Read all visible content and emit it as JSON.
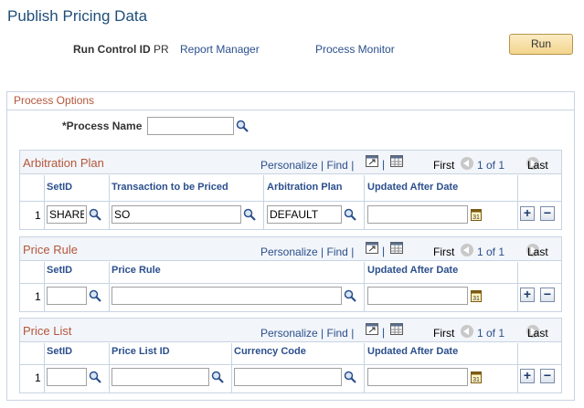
{
  "page": {
    "title": "Publish Pricing Data"
  },
  "run_control": {
    "label": "Run Control ID",
    "value": "PR",
    "report_manager": "Report Manager",
    "process_monitor": "Process Monitor",
    "run_button": "Run"
  },
  "process_options": {
    "title": "Process Options",
    "process_name_label": "*Process Name",
    "process_name_value": ""
  },
  "arbitration_plan": {
    "title": "Arbitration Plan",
    "personalize": "Personalize",
    "find": "Find",
    "first": "First",
    "range": "1 of 1",
    "last": "Last",
    "columns": [
      "SetID",
      "Transaction to be Priced",
      "Arbitration Plan",
      "Updated After Date"
    ],
    "rows": [
      {
        "num": "1",
        "setid": "SHARE",
        "transaction": "SO",
        "plan": "DEFAULT",
        "date": ""
      }
    ]
  },
  "price_rule": {
    "title": "Price Rule",
    "personalize": "Personalize",
    "find": "Find",
    "first": "First",
    "range": "1 of 1",
    "last": "Last",
    "columns": [
      "SetID",
      "Price Rule",
      "Updated After Date"
    ],
    "rows": [
      {
        "num": "1",
        "setid": "",
        "rule": "",
        "date": ""
      }
    ]
  },
  "price_list": {
    "title": "Price List",
    "personalize": "Personalize",
    "find": "Find",
    "first": "First",
    "range": "1 of 1",
    "last": "Last",
    "columns": [
      "SetID",
      "Price List ID",
      "Currency Code",
      "Updated After Date"
    ],
    "rows": [
      {
        "num": "1",
        "setid": "",
        "list_id": "",
        "currency": "",
        "date": ""
      }
    ]
  },
  "separator": "|",
  "colors": {
    "title": "#1f4e79",
    "link": "#2b4f8c",
    "section": "#b4563c",
    "border": "#c8d4e3"
  }
}
